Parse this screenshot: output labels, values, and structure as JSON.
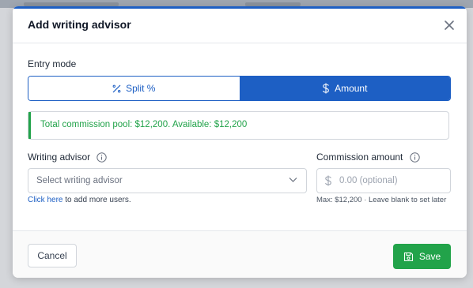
{
  "dialog": {
    "title": "Add writing advisor"
  },
  "entry_mode": {
    "label": "Entry mode",
    "options": [
      {
        "label": "Split %",
        "icon": "percent-icon",
        "selected": false
      },
      {
        "label": "Amount",
        "icon": "dollar-icon",
        "selected": true
      }
    ]
  },
  "pool": {
    "text": "Total commission pool: $12,200. Available: $12,200"
  },
  "advisor": {
    "label": "Writing advisor",
    "placeholder": "Select writing advisor",
    "helper_link": "Click here",
    "helper_rest": " to add more users."
  },
  "commission": {
    "label": "Commission amount",
    "placeholder": "0.00 (optional)",
    "value": "",
    "hint": "Max: $12,200 · Leave blank to set later"
  },
  "footer": {
    "cancel_label": "Cancel",
    "save_label": "Save"
  },
  "colors": {
    "primary": "#1d5fc4",
    "success": "#22a34a"
  }
}
